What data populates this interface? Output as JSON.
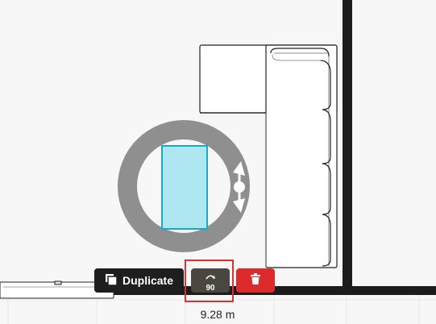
{
  "toolbar": {
    "duplicate_label": "Duplicate",
    "rotate_label": "90"
  },
  "dimension": {
    "label": "9.28 m"
  },
  "colors": {
    "wall": "#1c1c1c",
    "selected_object": "#aee7f2",
    "selected_border": "#19a9c6",
    "rotate_ring": "#8f8f8f",
    "delete": "#dd2a2a"
  },
  "icons": {
    "duplicate": "duplicate-icon",
    "rotate": "rotate-icon",
    "delete": "trash-icon",
    "rotate_handle": "rotate-handle-icon"
  }
}
